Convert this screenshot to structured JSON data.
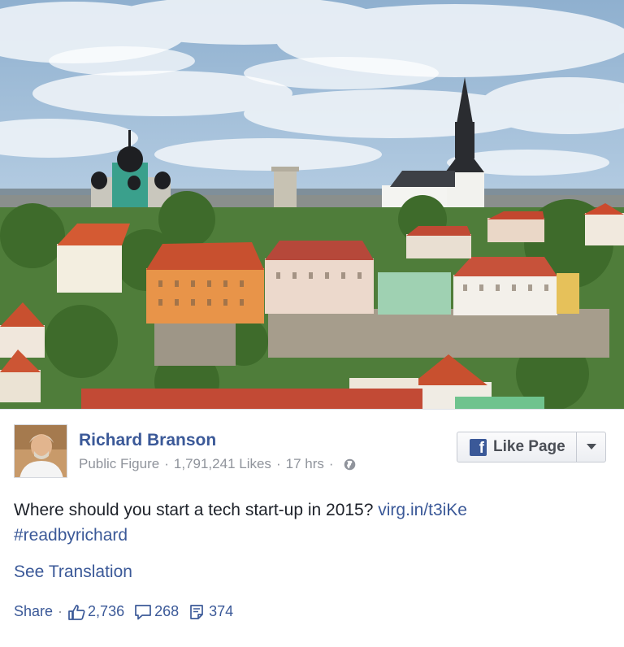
{
  "post": {
    "author": "Richard Branson",
    "category": "Public Figure",
    "likes": "1,791,241 Likes",
    "time": "17 hrs",
    "separator": "·",
    "text": "Where should you start a tech start-up in 2015?",
    "link": "virg.in/t3iKe",
    "hashtag": "#readbyrichard",
    "see_translation": "See Translation"
  },
  "like_button": {
    "label": "Like Page",
    "logo": "f"
  },
  "actions": {
    "share": "Share",
    "dot": "·",
    "like_count": "2,736",
    "comment_count": "268",
    "share_count": "374"
  },
  "icons": [
    "globe-icon",
    "facebook-logo-icon",
    "chevron-down-icon",
    "thumbs-up-icon",
    "comment-icon",
    "share-count-icon"
  ],
  "colors": {
    "link": "#3b5998",
    "meta": "#90949c",
    "text": "#1d2129",
    "roof": "#c8502f",
    "sky": "#a9c4dc"
  }
}
